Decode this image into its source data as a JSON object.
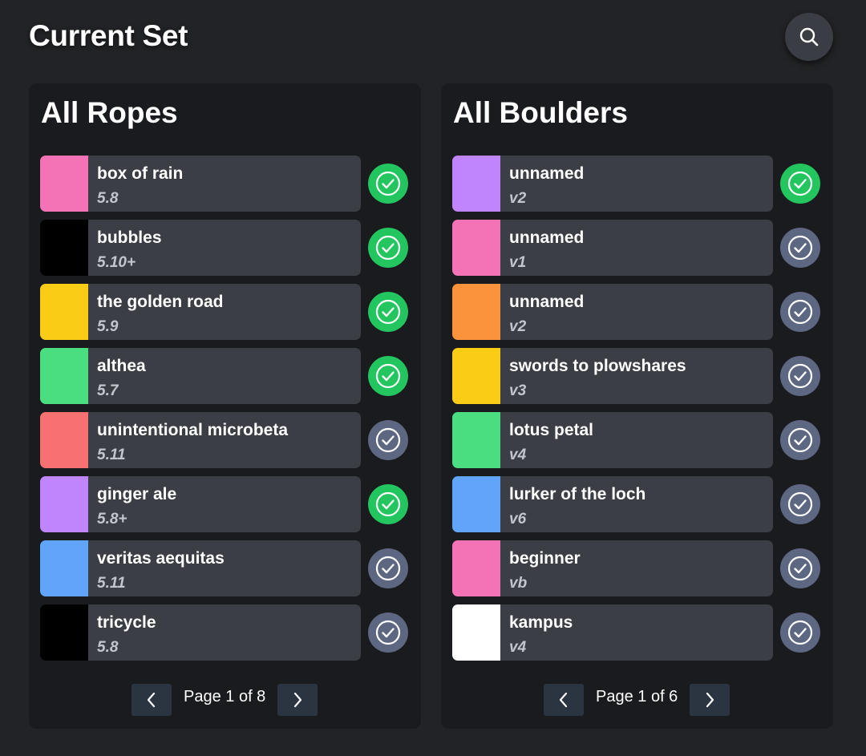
{
  "header": {
    "title": "Current Set",
    "search_icon": "search-icon"
  },
  "colors": {
    "background": "#222326",
    "panel": "#1a1b1e",
    "card": "#3b3e45",
    "check_on": "#22c55e",
    "check_off": "#5d6781"
  },
  "ropes": {
    "title": "All Ropes",
    "items": [
      {
        "name": "box of rain",
        "grade": "5.8",
        "color": "#f472b6",
        "checked": true
      },
      {
        "name": "bubbles",
        "grade": "5.10+",
        "color": "#000000",
        "checked": true
      },
      {
        "name": "the golden road",
        "grade": "5.9",
        "color": "#facc15",
        "checked": true
      },
      {
        "name": "althea",
        "grade": "5.7",
        "color": "#4ade80",
        "checked": true
      },
      {
        "name": "unintentional microbeta",
        "grade": "5.11",
        "color": "#f87171",
        "checked": false
      },
      {
        "name": "ginger ale",
        "grade": "5.8+",
        "color": "#c084fc",
        "checked": true
      },
      {
        "name": "veritas aequitas",
        "grade": "5.11",
        "color": "#60a5fa",
        "checked": false
      },
      {
        "name": "tricycle",
        "grade": "5.8",
        "color": "#000000",
        "checked": false
      }
    ],
    "pagination": {
      "label": "Page 1 of 8",
      "prev_icon": "chevron-left-icon",
      "next_icon": "chevron-right-icon"
    }
  },
  "boulders": {
    "title": "All Boulders",
    "items": [
      {
        "name": "unnamed",
        "grade": "v2",
        "color": "#c084fc",
        "checked": true
      },
      {
        "name": "unnamed",
        "grade": "v1",
        "color": "#f472b6",
        "checked": false
      },
      {
        "name": "unnamed",
        "grade": "v2",
        "color": "#fb923c",
        "checked": false
      },
      {
        "name": "swords to plowshares",
        "grade": "v3",
        "color": "#facc15",
        "checked": false
      },
      {
        "name": "lotus petal",
        "grade": "v4",
        "color": "#4ade80",
        "checked": false
      },
      {
        "name": "lurker of the loch",
        "grade": "v6",
        "color": "#60a5fa",
        "checked": false
      },
      {
        "name": "beginner",
        "grade": "vb",
        "color": "#f472b6",
        "checked": false
      },
      {
        "name": "kampus",
        "grade": "v4",
        "color": "#ffffff",
        "checked": false
      }
    ],
    "pagination": {
      "label": "Page 1 of 6",
      "prev_icon": "chevron-left-icon",
      "next_icon": "chevron-right-icon"
    }
  }
}
